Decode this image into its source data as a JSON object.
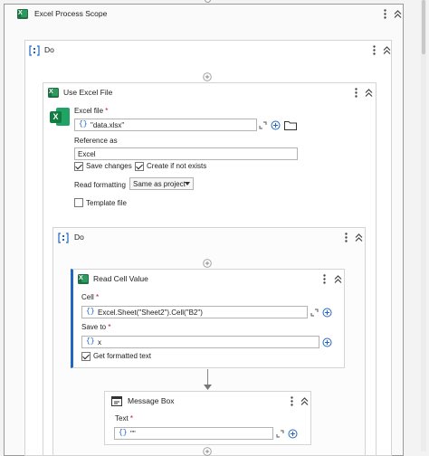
{
  "outer_scope": {
    "title": "Excel Process Scope"
  },
  "do_main": {
    "title": "Do"
  },
  "use_excel_file": {
    "title": "Use Excel File",
    "excel_file_label": "Excel file",
    "required_mark": "*",
    "excel_file_value": "\"data.xlsx\"",
    "reference_label": "Reference as",
    "reference_value": "Excel",
    "save_changes": {
      "label": "Save changes",
      "checked": true
    },
    "create_if_not_exists": {
      "label": "Create if not exists",
      "checked": true
    },
    "read_formatting_label": "Read formatting",
    "read_formatting_value": "Same as project",
    "template_file": {
      "label": "Template file",
      "checked": false
    }
  },
  "do_inner": {
    "title": "Do"
  },
  "read_cell_value": {
    "title": "Read Cell Value",
    "cell_label": "Cell",
    "required_mark": "*",
    "cell_value": "Excel.Sheet(\"Sheet2\").Cell(\"B2\")",
    "save_to_label": "Save to",
    "save_to_value": "x",
    "get_formatted_text": {
      "label": "Get formatted text",
      "checked": true
    }
  },
  "message_box": {
    "title": "Message Box",
    "text_label": "Text",
    "required_mark": "*",
    "text_value": "\"\""
  },
  "glyphs": {
    "brace": "{}"
  },
  "colors": {
    "excel_green": "#1e7145",
    "expression_blue": "#2266c4",
    "required_red": "#c50f1f"
  }
}
